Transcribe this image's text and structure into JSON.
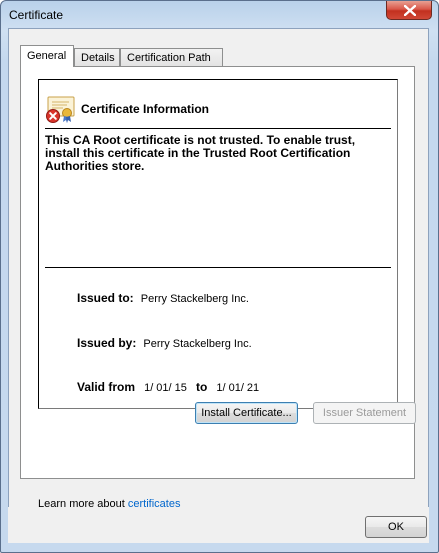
{
  "window": {
    "title": "Certificate"
  },
  "tabs": [
    {
      "label": "General",
      "active": true
    },
    {
      "label": "Details",
      "active": false
    },
    {
      "label": "Certification Path",
      "active": false
    }
  ],
  "info": {
    "heading": "Certificate Information",
    "warning": "This CA Root certificate is not trusted. To enable trust, install this certificate in the Trusted Root Certification Authorities store.",
    "issued_to_label": "Issued to:",
    "issued_to_value": "Perry Stackelberg Inc.",
    "issued_by_label": "Issued by:",
    "issued_by_value": "Perry Stackelberg Inc.",
    "valid_from_label": "Valid from",
    "valid_from_value": "1/ 01/ 15",
    "valid_to_label": "to",
    "valid_to_value": "1/ 01/ 21"
  },
  "buttons": {
    "install": "Install Certificate...",
    "issuer": "Issuer Statement",
    "ok": "OK"
  },
  "footer": {
    "learn_text": "Learn more about ",
    "learn_link": "certificates"
  },
  "icons": {
    "certificate": "certificate-error-icon",
    "close": "close-icon"
  },
  "colors": {
    "close_button": "#c8402f",
    "link": "#0066cc"
  }
}
